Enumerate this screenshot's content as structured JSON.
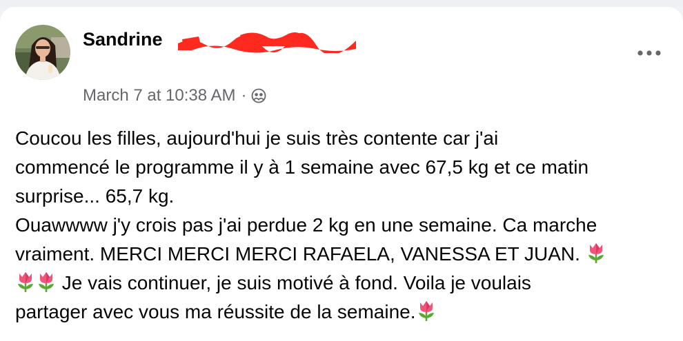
{
  "post": {
    "author": {
      "name": "Sandrine",
      "avatar_icon": "profile-photo"
    },
    "timestamp": "March 7 at 10:38 AM",
    "separator": "·",
    "audience_icon": "group-audience-icon",
    "more_label": "•••",
    "body": {
      "line1": "Coucou les filles, aujourd'hui je suis très contente car j'ai",
      "line2": "commencé le programme il y à 1 semaine avec 67,5 kg et ce matin",
      "line3": "surprise... 65,7 kg.",
      "line4": "Ouawwww j'y crois pas j'ai perdue 2 kg en une semaine. Ca marche",
      "line5": "vraiment. MERCI MERCI MERCI RAFAELA, VANESSA ET JUAN. ",
      "line6": " Je vais continuer, je suis motivé à fond. Voila je voulais",
      "line7": "partager avec vous ma réussite de la semaine."
    },
    "emoji_icon": "tulip-emoji",
    "colors": {
      "name": "#050505",
      "meta": "#65676b",
      "redaction": "#ff2a1f",
      "tulip": "#f2557a",
      "stem": "#5aa832"
    }
  }
}
